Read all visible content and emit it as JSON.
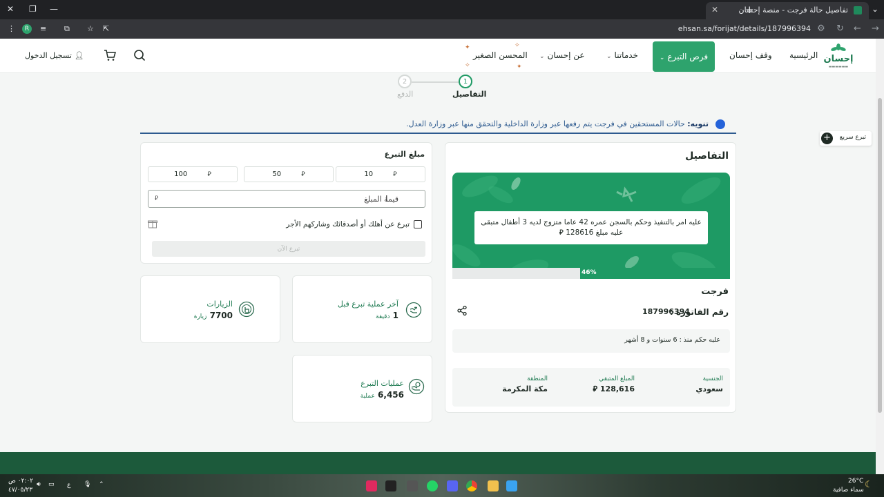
{
  "browser": {
    "tab_title": "تفاصيل حالة فرجت - منصة إحسان",
    "url": "ehsan.sa/forijat/details/187996394",
    "profile_initial": "R",
    "icons": [
      "chevron-down-icon",
      "close-icon",
      "plus-icon",
      "minimize-icon",
      "maximize-icon",
      "back-icon",
      "forward-icon",
      "reload-icon",
      "star-icon",
      "menu-icon"
    ]
  },
  "header": {
    "logo_text": "إحسان",
    "nav": {
      "home": "الرئيسية",
      "waqf": "وقف إحسان",
      "opportunities": "فرص التبرع",
      "services": "خدماتنا",
      "about": "عن إحسان",
      "little_donor": "المحسن الصغير"
    },
    "login": "تسجيل الدخول"
  },
  "stepper": {
    "step1_num": "1",
    "step1_label": "التفاصيل",
    "step2_num": "2",
    "step2_label": "الدفع"
  },
  "notice": {
    "label": "تنويه:",
    "text": "حالات المستحقين في فرجت يتم رفعها عبر وزارة الداخلية والتحقق منها عبر وزارة العدل."
  },
  "details": {
    "title": "التفاصيل",
    "banner_text": "عليه امر بالتنفيذ وحكم بالسجن عمره 42 عاما متزوج لديه 3 أطفال متبقى عليه مبلغ 128616 ⃁",
    "progress_percent": 46,
    "progress_label": "46%",
    "category": "فرجت",
    "invoice_label": "رقم الفاتورة :",
    "invoice_number": "187996394",
    "sentence_info": "عليه حكم منذ : 6 سنوات و 8 أشهر",
    "nationality_label": "الجنسية",
    "nationality_value": "سعودي",
    "remaining_label": "المبلغ المتبقي",
    "remaining_value": "128,616",
    "region_label": "المنطقة",
    "region_value": "مكة المكرمة"
  },
  "donation": {
    "title": "مبلغ التبرع",
    "preset_10": "10",
    "preset_50": "50",
    "preset_100": "100",
    "currency_symbol": "⃁",
    "amount_placeholder": "قيمة المبلغ",
    "gift_label": "تبرع عن أهلك أو أصدقائك وشاركهم الأجر",
    "donate_now": "تبرع الآن"
  },
  "stats": {
    "last_donation_label": "آخر عملية تبرع قبل",
    "last_donation_value": "1",
    "last_donation_unit": "دقيقة",
    "visits_label": "الزيارات",
    "visits_value": "7700",
    "visits_unit": "زيارة",
    "donations_label": "عمليات التبرع",
    "donations_value": "6,456",
    "donations_unit": "عملية"
  },
  "quick_donate": "تبرع سريع",
  "taskbar": {
    "temperature": "26°C",
    "weather": "سماء صافية",
    "time": "٠٢:٠٢ ص",
    "date": "٤٧/٠٥/٢٣",
    "language": "ع"
  },
  "colors": {
    "brand_green": "#1e9a64",
    "nav_active": "#2ea36d",
    "notice_blue": "#2d5a8f",
    "footer": "#1c5a3b"
  }
}
